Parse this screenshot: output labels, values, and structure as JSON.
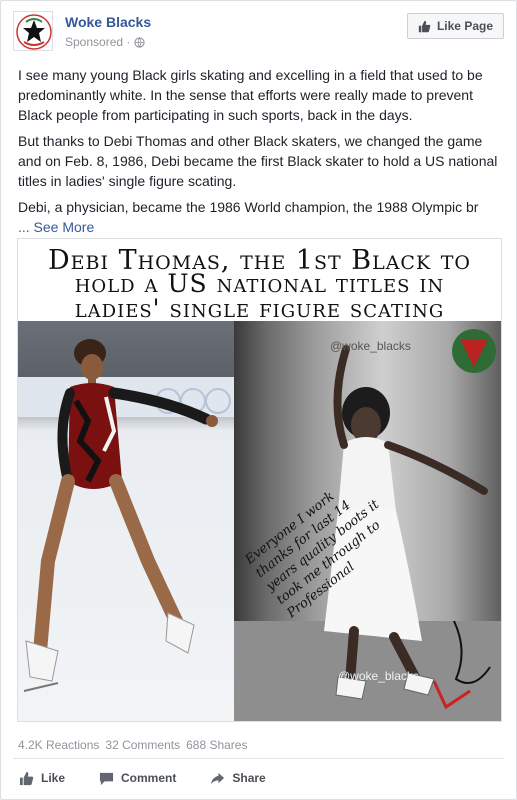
{
  "post": {
    "page_name": "Woke Blacks",
    "sponsored_label": "Sponsored ·",
    "like_page_label": "Like Page",
    "paragraphs": [
      "I see many young Black girls skating and excelling in a field that used to be predominantly white. In the sense that efforts were really made to prevent Black people from participating in such sports, back in the days.",
      "But thanks to Debi Thomas and other Black skaters, we changed the game and on Feb. 8, 1986, Debi became the first Black skater to hold a US national titles in ladies' single figure scating.",
      "Debi, a physician, became the 1986 World champion, the 1988 Olympic br"
    ],
    "see_more_label": "... See More"
  },
  "image": {
    "title_line1": "Debi Thomas, the 1st Black to",
    "title_line2": "hold a US national titles in",
    "title_line3": "ladies' single figure scating",
    "watermark_top": "@woke_blacks",
    "watermark_bottom": "@woke_blacks",
    "autograph": "Everyone I work thanks for last 14 years quality boots it took me through to Professional"
  },
  "stats": {
    "reactions": "4.2K Reactions",
    "comments": "32 Comments",
    "shares": "688 Shares"
  },
  "actions": {
    "like": "Like",
    "comment": "Comment",
    "share": "Share"
  },
  "colors": {
    "link": "#365899",
    "meta": "#90949c",
    "text": "#1d2129"
  }
}
